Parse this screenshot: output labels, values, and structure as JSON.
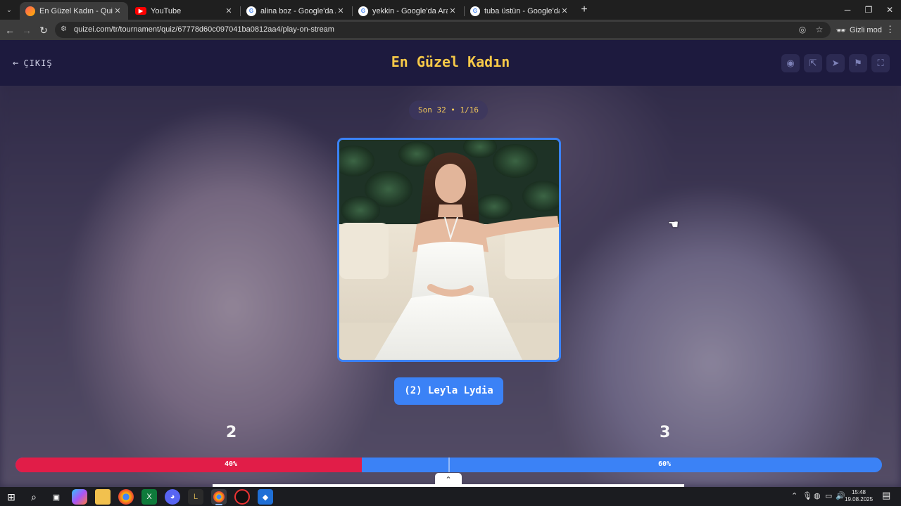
{
  "browser": {
    "tabs": [
      {
        "title": "En Güzel Kadın - Quizei",
        "favicon": "quizei-icon",
        "active": true
      },
      {
        "title": "YouTube",
        "favicon": "youtube-icon",
        "active": false
      },
      {
        "title": "alina boz - Google'da Ara",
        "favicon": "google-icon",
        "active": false
      },
      {
        "title": "yekkin - Google'da Ara",
        "favicon": "google-icon",
        "active": false
      },
      {
        "title": "tuba üstün - Google'da Ara",
        "favicon": "google-icon",
        "active": false
      }
    ],
    "url": "quizei.com/tr/tournament/quiz/67778d60c097041ba0812aa4/play-on-stream",
    "incognito_label": "Gizli mod"
  },
  "page": {
    "exit_label": "ÇIKIŞ",
    "title": "En Güzel Kadın",
    "round_label": "Son 32 • 1/16",
    "choice_label": "(2) Leyla Lydia",
    "votes": {
      "left_count": "2",
      "right_count": "3",
      "left_percent_label": "40%",
      "right_percent_label": "60%",
      "left_fraction": 0.4,
      "left_color": "#e11d48",
      "right_color": "#3b82f6"
    },
    "accent_color": "#f7c948"
  },
  "taskbar": {
    "time": "15:48",
    "date": "19.08.2025"
  }
}
